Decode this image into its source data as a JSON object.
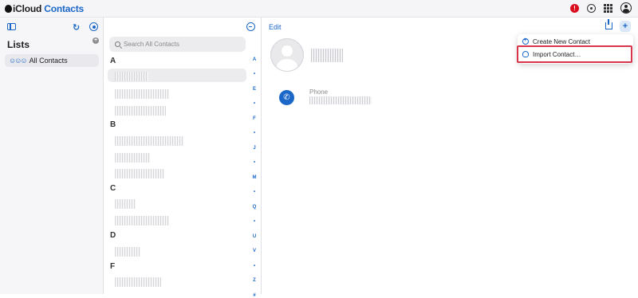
{
  "app": {
    "brand_prefix": "iCloud",
    "brand_name": "Contacts",
    "alert_count": "!"
  },
  "sidebar": {
    "heading": "Lists",
    "items": [
      {
        "label": "All Contacts",
        "icon": "people-icon",
        "selected": true
      }
    ]
  },
  "contact_list": {
    "search_placeholder": "Search All Contacts",
    "sections": [
      {
        "letter": "A",
        "rows": 3
      },
      {
        "letter": "B",
        "rows": 3
      },
      {
        "letter": "C",
        "rows": 2
      },
      {
        "letter": "D",
        "rows": 1
      },
      {
        "letter": "F",
        "rows": 1
      }
    ],
    "index": [
      "A",
      "•",
      "E",
      "•",
      "F",
      "•",
      "J",
      "•",
      "M",
      "•",
      "Q",
      "•",
      "U",
      "V",
      "•",
      "Z",
      "#"
    ]
  },
  "detail": {
    "edit_label": "Edit",
    "phone_label": "Phone"
  },
  "menu": {
    "items": [
      {
        "label": "Create New Contact",
        "icon": "plus-circle-icon"
      },
      {
        "label": "Import Contact…",
        "icon": "cloud-upload-icon",
        "highlighted": true
      }
    ]
  },
  "colors": {
    "accent": "#1a67c8",
    "highlight_border": "#d8354b",
    "alert": "#d90b1c"
  }
}
